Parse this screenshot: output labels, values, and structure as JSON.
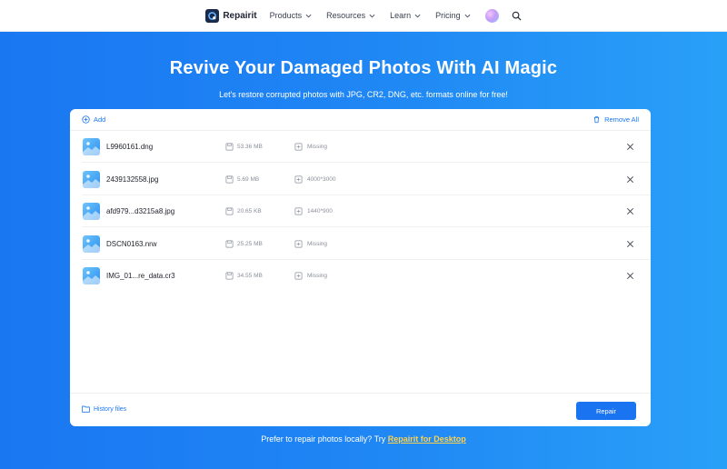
{
  "nav": {
    "brand": "Repairit",
    "items": [
      {
        "label": "Products"
      },
      {
        "label": "Resources"
      },
      {
        "label": "Learn"
      },
      {
        "label": "Pricing"
      }
    ]
  },
  "hero": {
    "title": "Revive Your Damaged Photos With AI Magic",
    "subtitle": "Let's restore corrupted photos with JPG, CR2, DNG, etc. formats online for free!"
  },
  "card": {
    "add_label": "Add",
    "remove_all_label": "Remove All",
    "files": [
      {
        "name": "L9960161.dng",
        "size": "53.36 MB",
        "dimensions": "Missing"
      },
      {
        "name": "2439132558.jpg",
        "size": "5.69 MB",
        "dimensions": "4000*3000"
      },
      {
        "name": "afd979...d3215a8.jpg",
        "size": "20.65 KB",
        "dimensions": "1440*900"
      },
      {
        "name": "DSCN0163.nrw",
        "size": "25.25 MB",
        "dimensions": "Missing"
      },
      {
        "name": "IMG_01...re_data.cr3",
        "size": "34.55 MB",
        "dimensions": "Missing"
      }
    ],
    "history_label": "History files",
    "repair_label": "Repair"
  },
  "footer": {
    "prefix": "Prefer to repair photos locally? Try ",
    "link": "Repairit for Desktop"
  },
  "colors": {
    "accent": "#1a77f2",
    "link_highlight": "#ffd24d"
  }
}
